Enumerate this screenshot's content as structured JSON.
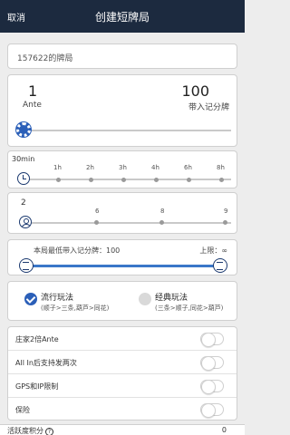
{
  "header": {
    "cancel_label": "取消",
    "title": "创建短牌局"
  },
  "game_name": {
    "value": "157622的牌局"
  },
  "ante": {
    "value": "1",
    "label": "Ante",
    "buyin_value": "100",
    "buyin_label": "带入记分牌"
  },
  "duration": {
    "selected": "30min",
    "ticks": [
      "1h",
      "2h",
      "3h",
      "4h",
      "6h",
      "8h"
    ]
  },
  "players": {
    "selected": "2",
    "ticks": [
      "6",
      "8",
      "9"
    ]
  },
  "buyin_limits": {
    "min_label": "本局最低带入记分牌：100",
    "max_label": "上限：∞"
  },
  "modes": [
    {
      "title": "流行玩法",
      "subtitle": "(顺子>三条,葫芦>同花)",
      "selected": true
    },
    {
      "title": "经典玩法",
      "subtitle": "(三条>顺子,同花>葫芦)",
      "selected": false
    }
  ],
  "options": [
    {
      "label": "庄家2倍Ante"
    },
    {
      "label": "All In后支持发两次"
    },
    {
      "label": "GPS和IP限制"
    },
    {
      "label": "保险"
    }
  ],
  "activity": {
    "label": "活跃度积分",
    "help_icon": "?",
    "value": "0"
  },
  "colors": {
    "header_bg": "#1c2a3f",
    "accent": "#2b5fb8"
  }
}
